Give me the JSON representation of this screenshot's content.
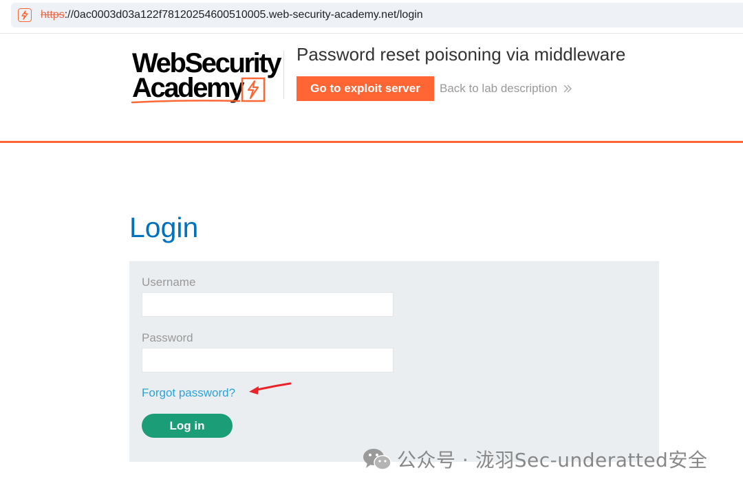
{
  "browser": {
    "url_scheme": "https",
    "url_rest": "://0ac0003d03a122f78120254600510005.web-security-academy.net/login",
    "site_icon": "lightning-bolt-icon"
  },
  "lab_header": {
    "logo_line1": "WebSecurity",
    "logo_line2": "Academy",
    "title": "Password reset poisoning via middleware",
    "exploit_button": "Go to exploit server",
    "back_link": "Back to lab description",
    "back_link_icon": "double-chevron-right-icon",
    "accent_color": "#ff6633"
  },
  "login": {
    "heading": "Login",
    "username_label": "Username",
    "username_value": "",
    "password_label": "Password",
    "password_value": "",
    "forgot_link": "Forgot password?",
    "submit_label": "Log in",
    "heading_color": "#0071bc",
    "button_color": "#1b9e77",
    "link_color": "#29a3d9"
  },
  "annotation": {
    "arrow_color": "#e8232a",
    "arrow_icon": "red-arrow-icon"
  },
  "watermark": {
    "text": "公众号 · 泷羽Sec-underatted安全",
    "icon": "wechat-icon"
  }
}
